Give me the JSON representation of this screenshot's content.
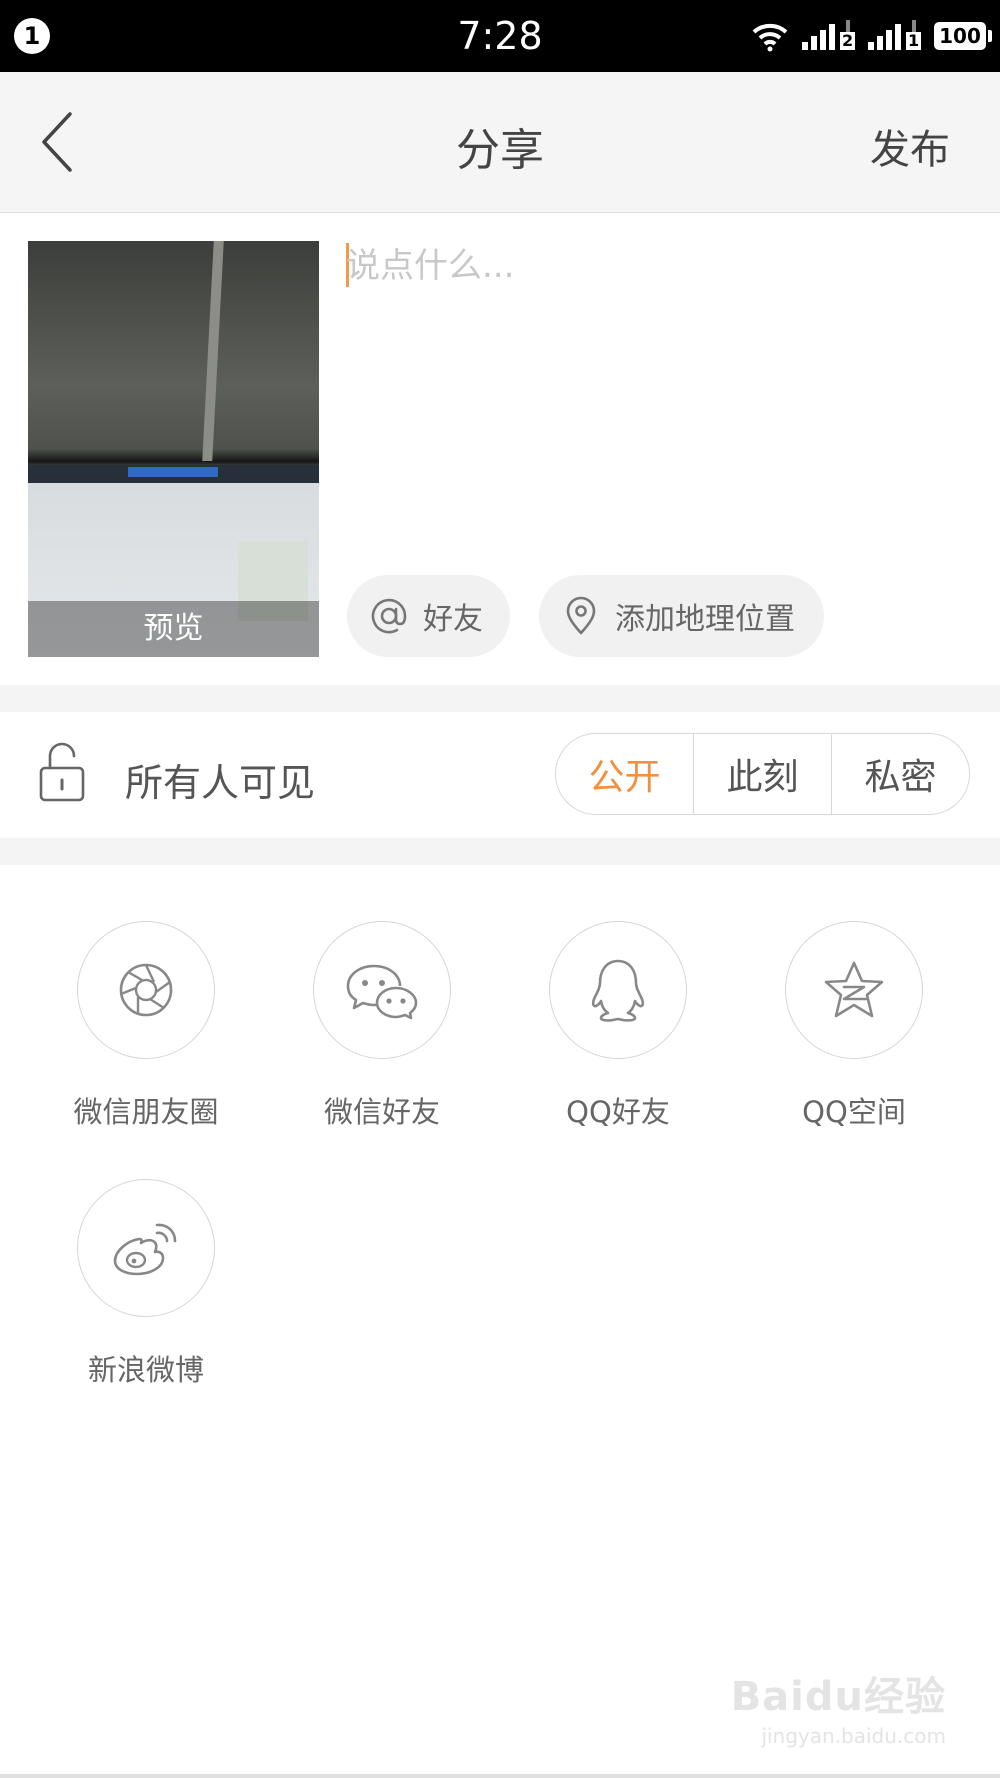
{
  "status_bar": {
    "notification_count": "1",
    "time": "7:28",
    "battery": "100",
    "sim1_label": "2",
    "sim2_label": "1"
  },
  "header": {
    "back_icon": "chevron-left-icon",
    "title": "分享",
    "publish_label": "发布"
  },
  "compose": {
    "placeholder": "说点什么...",
    "value": "",
    "preview_label": "预览",
    "mention_label": "好友",
    "location_label": "添加地理位置"
  },
  "privacy": {
    "label": "所有人可见",
    "options": [
      "公开",
      "此刻",
      "私密"
    ],
    "selected": "公开",
    "accent_color": "#f29040"
  },
  "share_targets": [
    {
      "label": "微信朋友圈",
      "icon": "wechat-moments-icon"
    },
    {
      "label": "微信好友",
      "icon": "wechat-icon"
    },
    {
      "label": "QQ好友",
      "icon": "qq-icon"
    },
    {
      "label": "QQ空间",
      "icon": "qzone-icon"
    },
    {
      "label": "新浪微博",
      "icon": "weibo-icon"
    }
  ],
  "watermark": {
    "main": "Baidu经验",
    "sub": "jingyan.baidu.com"
  }
}
